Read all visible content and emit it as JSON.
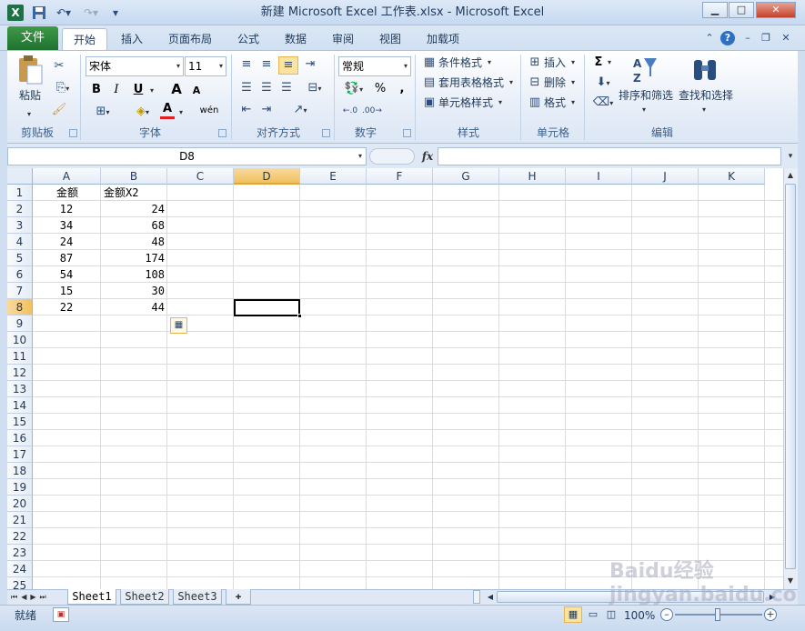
{
  "window": {
    "title": "新建 Microsoft Excel 工作表.xlsx  -  Microsoft Excel"
  },
  "quick_access": {
    "save_icon": "save-icon",
    "undo_icon": "undo-icon",
    "redo_icon": "redo-icon"
  },
  "tabs": {
    "file": "文件",
    "home": "开始",
    "insert": "插入",
    "page_layout": "页面布局",
    "formulas": "公式",
    "data": "数据",
    "review": "审阅",
    "view": "视图",
    "addins": "加载项"
  },
  "ribbon": {
    "clipboard": {
      "label": "剪贴板",
      "paste": "粘贴"
    },
    "font": {
      "label": "字体",
      "name": "宋体",
      "size": "11",
      "bold": "B",
      "italic": "I",
      "underline": "U",
      "grow": "A",
      "shrink": "A",
      "font_color": "A",
      "phonetic": "wén"
    },
    "alignment": {
      "label": "对齐方式"
    },
    "number": {
      "label": "数字",
      "format": "常规",
      "percent": "%",
      "comma": ","
    },
    "styles": {
      "label": "样式",
      "conditional": "条件格式",
      "table": "套用表格格式",
      "cell_styles": "单元格样式"
    },
    "cells": {
      "label": "单元格",
      "insert": "插入",
      "delete": "删除",
      "format": "格式"
    },
    "editing": {
      "label": "编辑",
      "sum": "Σ",
      "sort": "排序和筛选",
      "find": "查找和选择"
    }
  },
  "formula_bar": {
    "name_box": "D8",
    "fx": "fx",
    "value": ""
  },
  "grid": {
    "columns": [
      "A",
      "B",
      "C",
      "D",
      "E",
      "F",
      "G",
      "H",
      "I",
      "J",
      "K"
    ],
    "active_column": "D",
    "active_row": 8,
    "rows": [
      "1",
      "2",
      "3",
      "4",
      "5",
      "6",
      "7",
      "8",
      "9",
      "10",
      "11",
      "12",
      "13",
      "14",
      "15",
      "16",
      "17",
      "18",
      "19",
      "20",
      "21",
      "22",
      "23",
      "24",
      "25"
    ],
    "cells": [
      {
        "a": "金额",
        "b": "金额X2"
      },
      {
        "a": "12",
        "b": "24"
      },
      {
        "a": "34",
        "b": "68"
      },
      {
        "a": "24",
        "b": "48"
      },
      {
        "a": "87",
        "b": "174"
      },
      {
        "a": "54",
        "b": "108"
      },
      {
        "a": "15",
        "b": "30"
      },
      {
        "a": "22",
        "b": "44"
      }
    ]
  },
  "sheets": [
    "Sheet1",
    "Sheet2",
    "Sheet3"
  ],
  "status": {
    "mode": "就绪",
    "zoom": "100%"
  },
  "watermark": "Baidu经验 jingyan.baidu.com",
  "colors": {
    "ribbon": "#dce7f5",
    "file_tab": "#1f7130",
    "active_header": "#f1c15f"
  }
}
